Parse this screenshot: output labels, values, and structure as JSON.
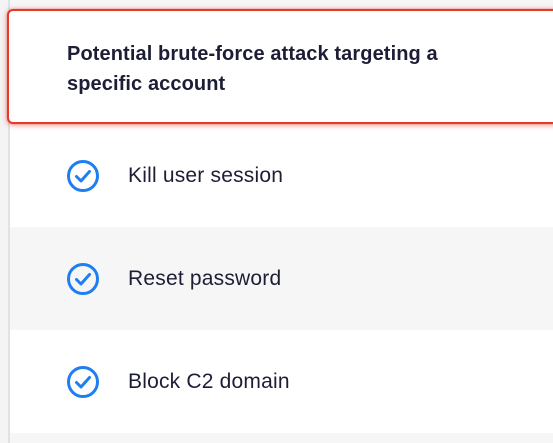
{
  "alert": {
    "title": "Potential brute-force attack targeting a specific account"
  },
  "actions": [
    {
      "label": "Kill user session",
      "icon": "check-circle-icon",
      "status": "completed"
    },
    {
      "label": "Reset password",
      "icon": "check-circle-icon",
      "status": "completed"
    },
    {
      "label": "Block C2 domain",
      "icon": "check-circle-icon",
      "status": "completed"
    }
  ],
  "colors": {
    "alert_border": "#e53a2b",
    "check": "#1f7ff0",
    "text": "#1d1e36"
  }
}
